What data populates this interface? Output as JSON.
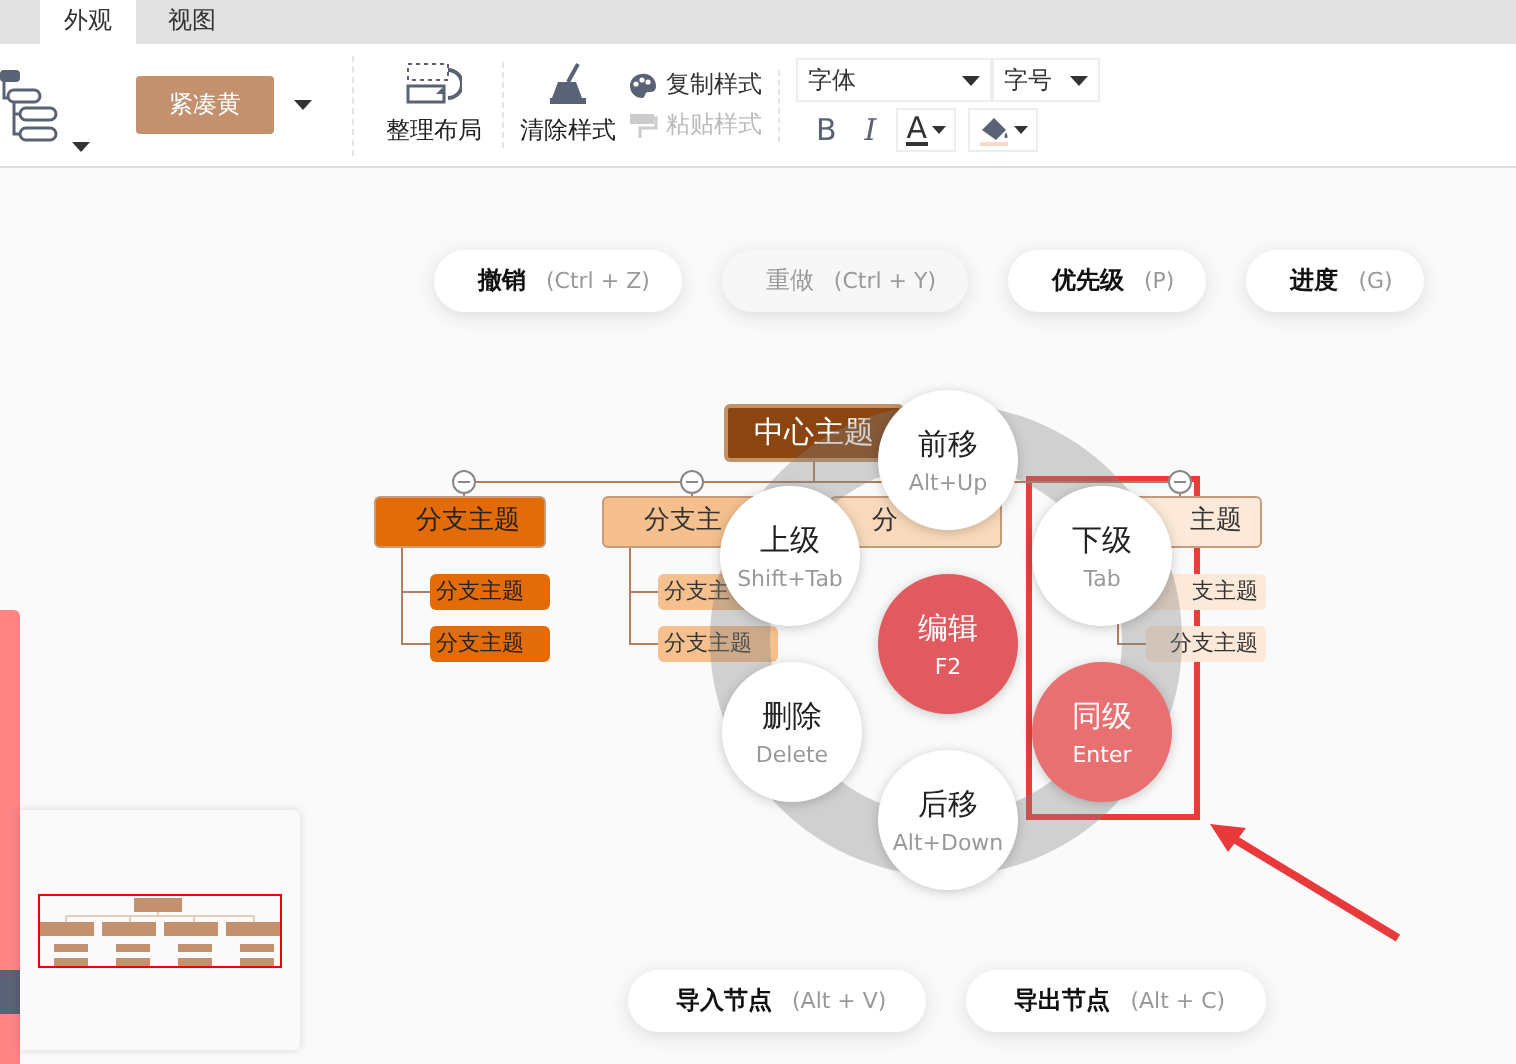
{
  "tabs": [
    {
      "label": "外观",
      "selected": true
    },
    {
      "label": "视图",
      "selected": false
    }
  ],
  "toolbar": {
    "theme": "紧凑黄",
    "arrange": "整理布局",
    "clear_style": "清除样式",
    "copy_style": {
      "label": "复制样式",
      "disabled": false
    },
    "paste_style": {
      "label": "粘贴样式",
      "disabled": true
    },
    "font_family": "字体",
    "font_size": "字号",
    "bold": "B",
    "italic": "I",
    "font_color": "A"
  },
  "action_buttons": [
    {
      "label": "撤销",
      "shortcut": "(Ctrl + Z)",
      "disabled": false
    },
    {
      "label": "重做",
      "shortcut": "(Ctrl + Y)",
      "disabled": true
    },
    {
      "label": "优先级",
      "shortcut": "(P)",
      "disabled": false
    },
    {
      "label": "进度",
      "shortcut": "(G)",
      "disabled": false
    }
  ],
  "mind_map": {
    "root": "中心主题",
    "branches": [
      {
        "label": "分支主题",
        "color": "#e36c09",
        "children": [
          {
            "label": "分支主题"
          },
          {
            "label": "分支主题"
          }
        ]
      },
      {
        "label": "分支主",
        "color": "#f5c08e",
        "children": [
          {
            "label": "分支主"
          },
          {
            "label": "分支主题"
          }
        ]
      },
      {
        "label": "分",
        "color": "#f8d9bb"
      },
      {
        "label": "主题",
        "color": "#fce9d9",
        "children": [
          {
            "label": "支主题"
          },
          {
            "label": "分支主题"
          }
        ]
      }
    ]
  },
  "radial_menu": [
    {
      "label": "前移",
      "shortcut": "Alt+Up",
      "kind": "normal"
    },
    {
      "label": "上级",
      "shortcut": "Shift+Tab",
      "kind": "normal"
    },
    {
      "label": "下级",
      "shortcut": "Tab",
      "kind": "normal"
    },
    {
      "label": "编辑",
      "shortcut": "F2",
      "kind": "primary"
    },
    {
      "label": "删除",
      "shortcut": "Delete",
      "kind": "normal"
    },
    {
      "label": "同级",
      "shortcut": "Enter",
      "kind": "highlight"
    },
    {
      "label": "后移",
      "shortcut": "Alt+Down",
      "kind": "normal"
    }
  ],
  "bottom_buttons": [
    {
      "label": "导入节点",
      "shortcut": "(Alt + V)"
    },
    {
      "label": "导出节点",
      "shortcut": "(Alt + C)"
    }
  ]
}
